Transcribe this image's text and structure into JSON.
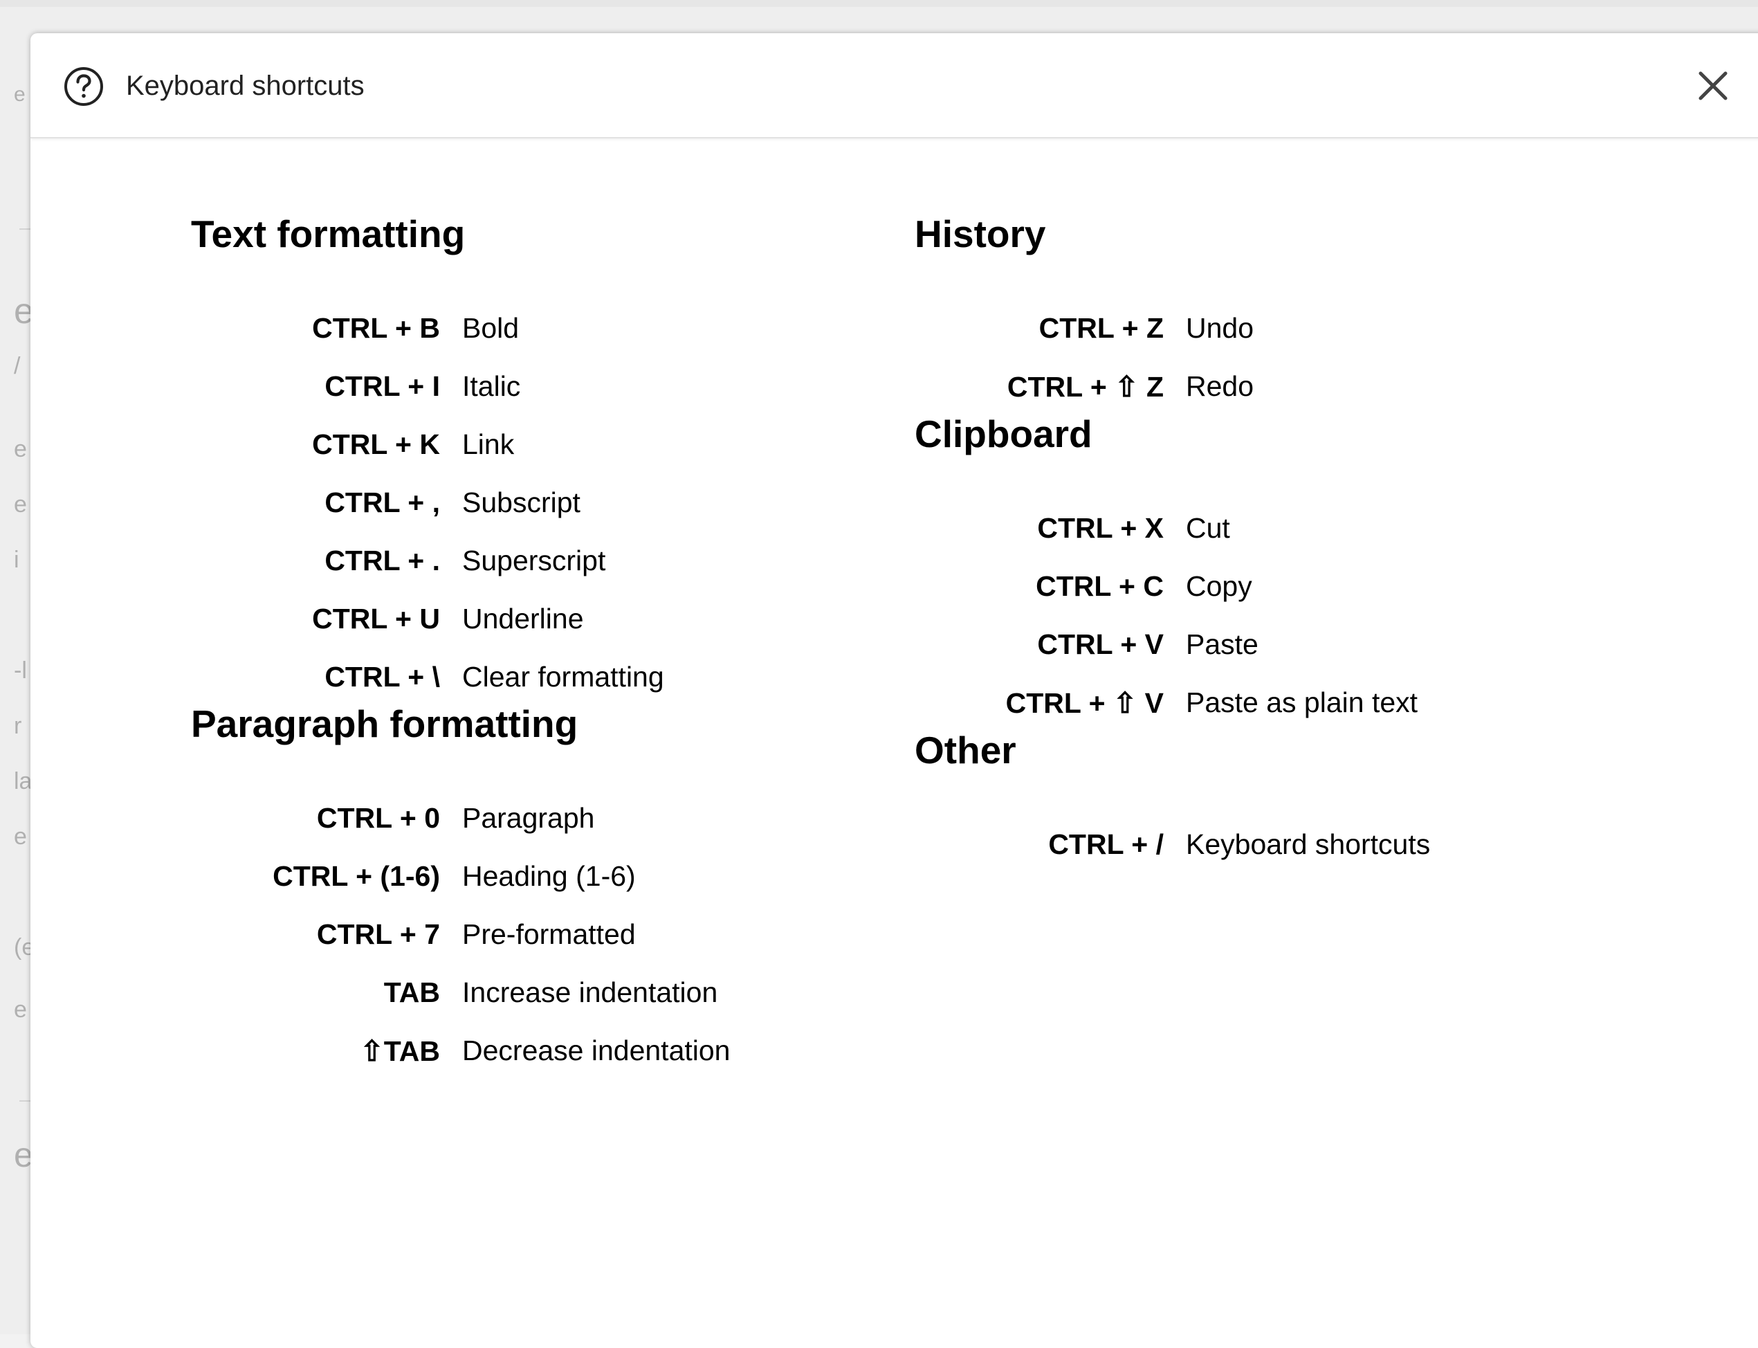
{
  "dialog": {
    "title": "Keyboard shortcuts",
    "icon": "help-circle-icon",
    "close_icon": "close-icon"
  },
  "sections": {
    "text_formatting": {
      "title": "Text formatting",
      "rows": [
        {
          "key": "CTRL + B",
          "desc": "Bold"
        },
        {
          "key": "CTRL + I",
          "desc": "Italic"
        },
        {
          "key": "CTRL + K",
          "desc": "Link"
        },
        {
          "key": "CTRL + ,",
          "desc": "Subscript"
        },
        {
          "key": "CTRL + .",
          "desc": "Superscript"
        },
        {
          "key": "CTRL + U",
          "desc": "Underline"
        },
        {
          "key": "CTRL + \\",
          "desc": "Clear formatting"
        }
      ]
    },
    "paragraph_formatting": {
      "title": "Paragraph formatting",
      "rows": [
        {
          "key": "CTRL + 0",
          "desc": "Paragraph"
        },
        {
          "key": "CTRL + (1-6)",
          "desc": "Heading (1-6)"
        },
        {
          "key": "CTRL + 7",
          "desc": "Pre-formatted"
        },
        {
          "key": "TAB",
          "desc": "Increase indentation"
        },
        {
          "key": "⇧TAB",
          "desc": "Decrease indentation"
        }
      ]
    },
    "history": {
      "title": "History",
      "rows": [
        {
          "key": "CTRL + Z",
          "desc": "Undo"
        },
        {
          "key": "CTRL + ⇧ Z",
          "desc": "Redo"
        }
      ]
    },
    "clipboard": {
      "title": "Clipboard",
      "rows": [
        {
          "key": "CTRL + X",
          "desc": "Cut"
        },
        {
          "key": "CTRL + C",
          "desc": "Copy"
        },
        {
          "key": "CTRL + V",
          "desc": "Paste"
        },
        {
          "key": "CTRL + ⇧ V",
          "desc": "Paste as plain text"
        }
      ]
    },
    "other": {
      "title": "Other",
      "rows": [
        {
          "key": "CTRL + /",
          "desc": "Keyboard shortcuts"
        }
      ]
    }
  },
  "background": {
    "fragments": [
      "e",
      "e",
      "/",
      "e",
      "e",
      "i",
      "-l",
      "r",
      "la",
      "e",
      "(e",
      "e",
      "e"
    ]
  }
}
